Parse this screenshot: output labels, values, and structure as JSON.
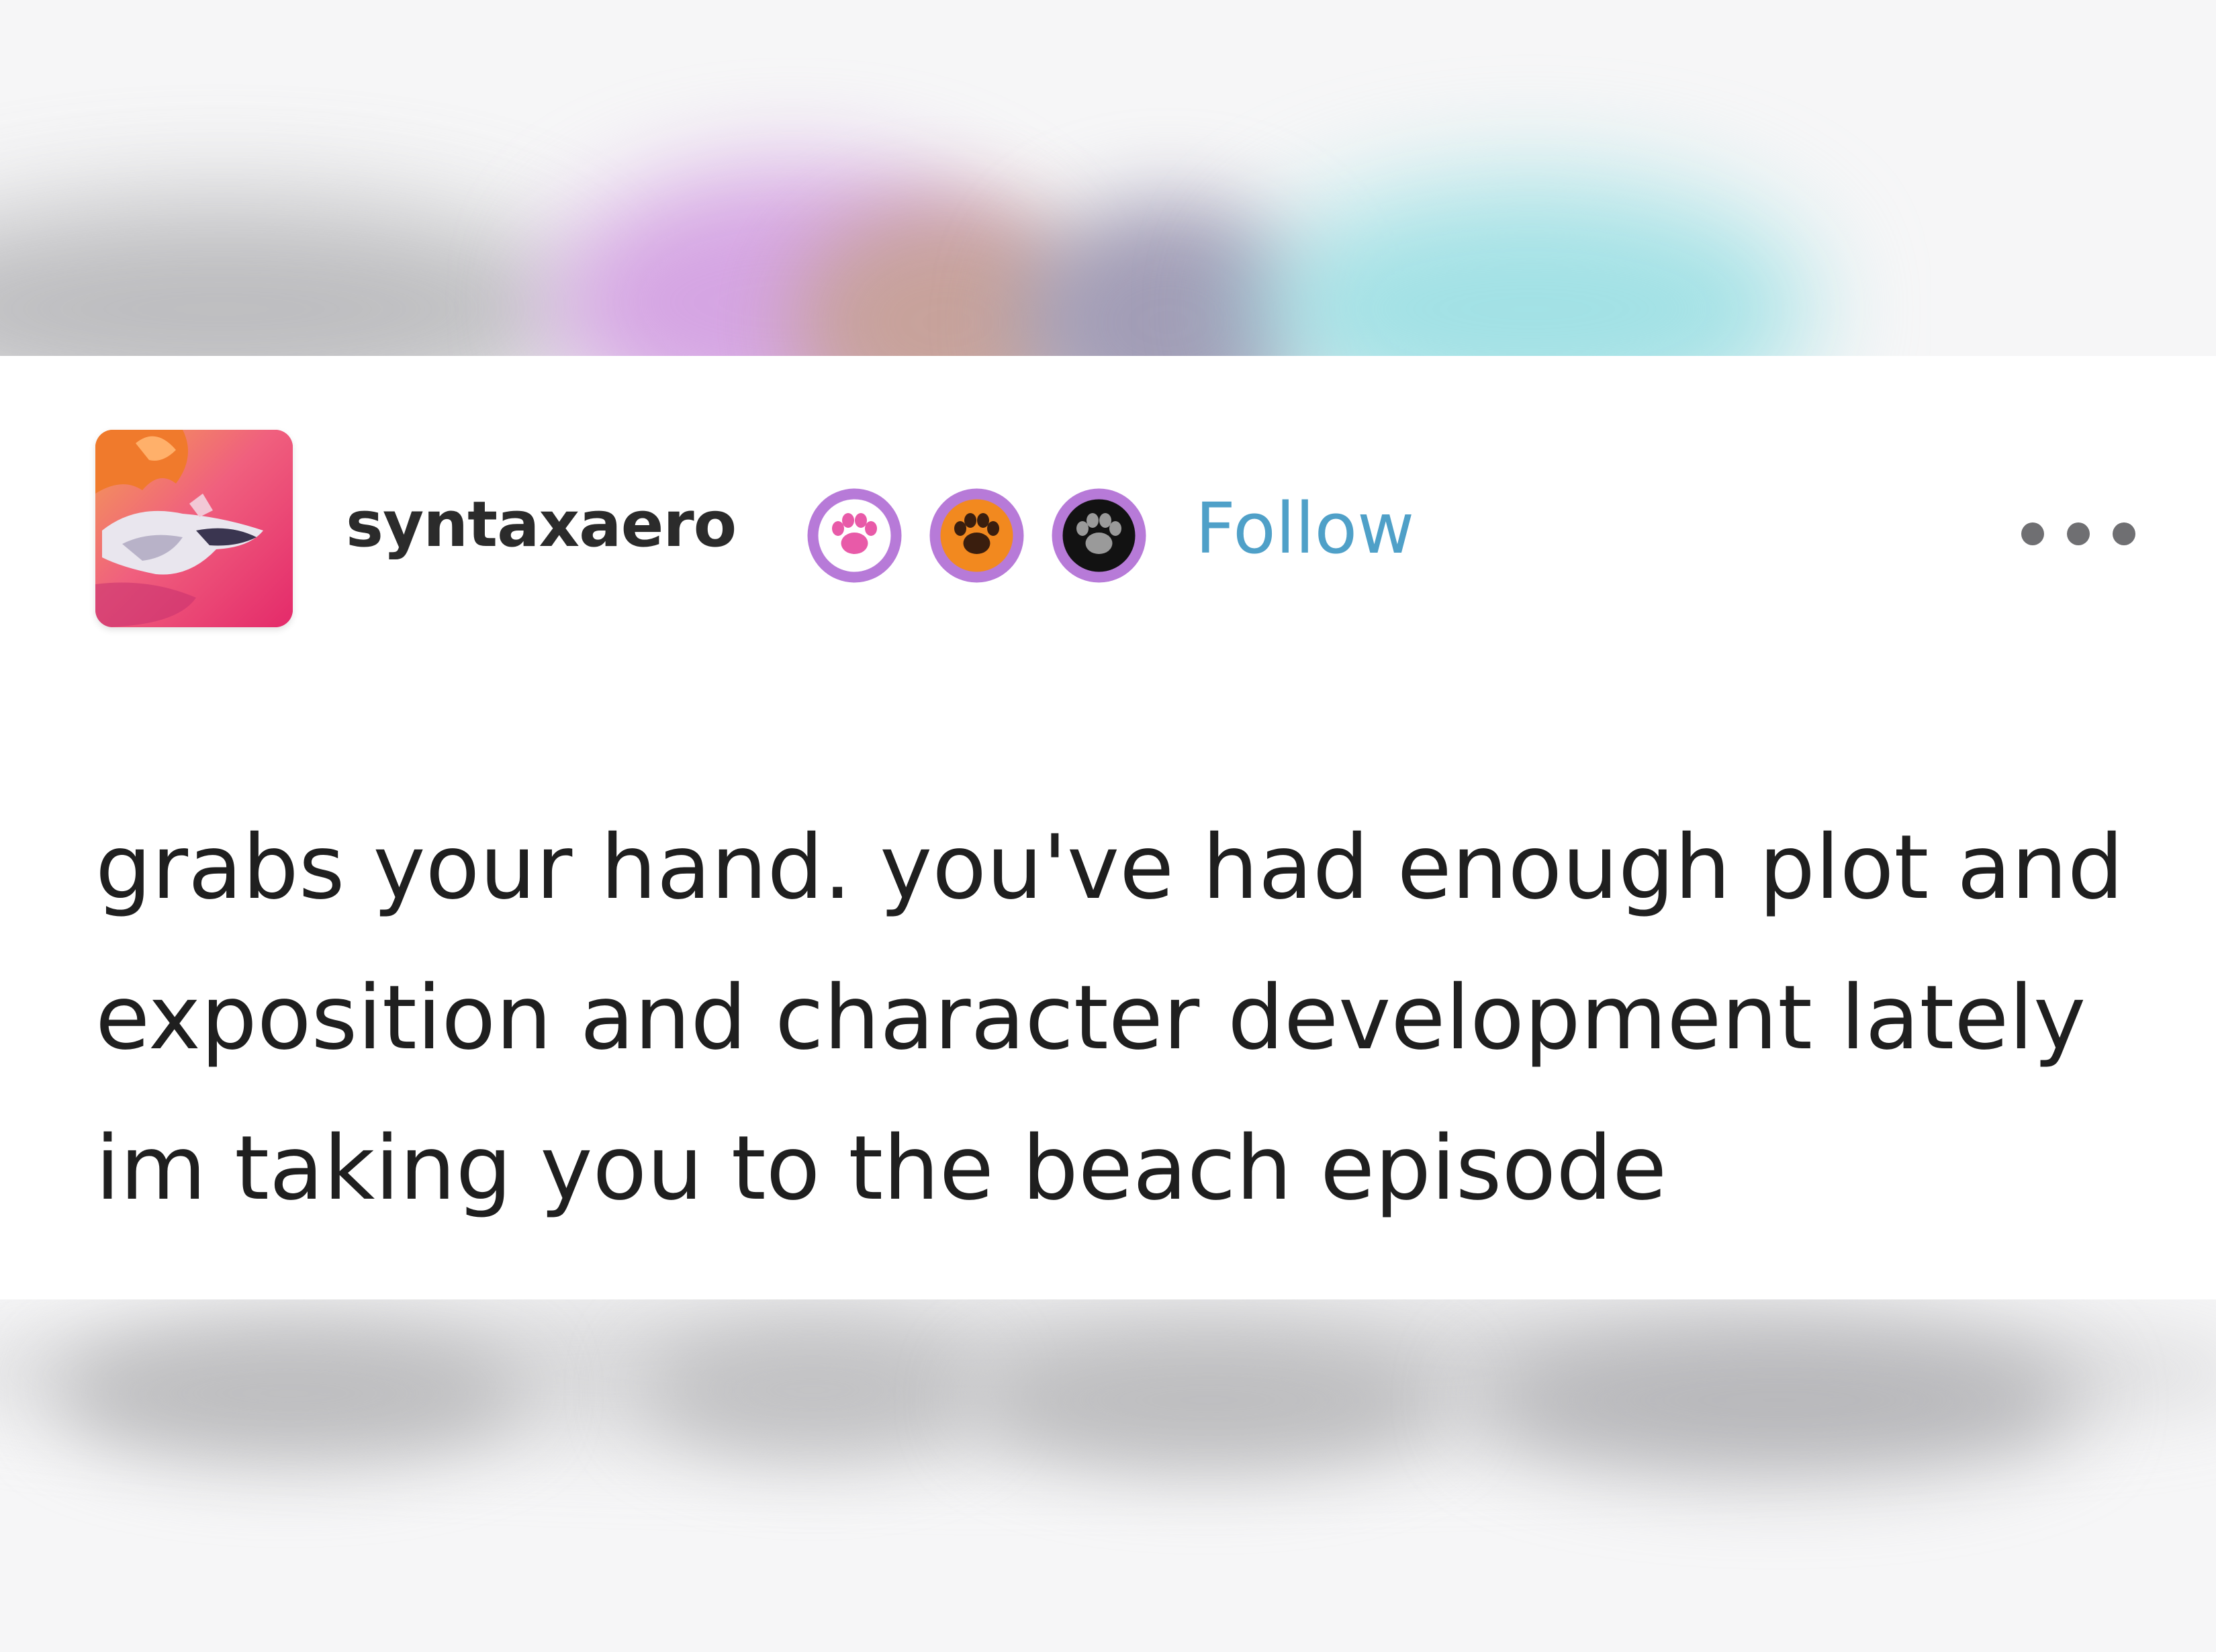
{
  "post": {
    "author": {
      "username": "syntaxaero",
      "avatar_icon": "avatar-artwork",
      "badges": [
        {
          "icon": "paw-icon",
          "ring_color": "#b77ad8",
          "fill_color": "#ffffff",
          "paw_color": "#e85aa8"
        },
        {
          "icon": "paw-icon",
          "ring_color": "#b77ad8",
          "fill_color": "#f2891f",
          "paw_color": "#3a1e0e"
        },
        {
          "icon": "paw-icon",
          "ring_color": "#b77ad8",
          "fill_color": "#121212",
          "paw_color": "#9a9a9a"
        }
      ]
    },
    "follow_label": "Follow",
    "more_icon": "more-options-icon",
    "text_lines": [
      "grabs your hand. you've had enough plot and",
      "exposition and character development lately",
      "im taking you to the beach episode"
    ]
  },
  "colors": {
    "follow": "#4fa0c8",
    "text": "#1f1f1f",
    "username": "#2b2b2b"
  }
}
